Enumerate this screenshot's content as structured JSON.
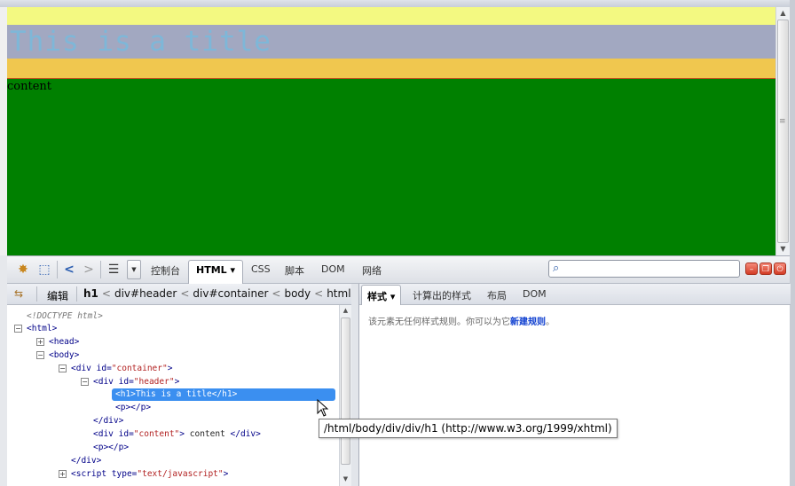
{
  "page": {
    "title_text": "This is a title",
    "content_text": "content",
    "colors": {
      "yellow": "#f3f981",
      "title_bg": "#a2a8c1",
      "title_fg": "#7eb7d8",
      "orange": "#f0c74f",
      "green": "#008000"
    }
  },
  "toolbar": {
    "icons": [
      "firebug-bug-icon",
      "inspect-element-icon",
      "back-icon",
      "forward-icon",
      "list-icon"
    ],
    "tabs": [
      {
        "label": "控制台"
      },
      {
        "label": "HTML",
        "active": true
      },
      {
        "label": "CSS"
      },
      {
        "label": "脚本"
      },
      {
        "label": "DOM"
      },
      {
        "label": "网络"
      }
    ],
    "html_dropdown": "▾",
    "search_placeholder": ""
  },
  "breadcrumb": {
    "edit_label": "编辑",
    "crumbs": [
      "h1",
      "div#header",
      "div#container",
      "body",
      "html"
    ],
    "separator": "<"
  },
  "tree": {
    "doctype": "<!DOCTYPE html>",
    "html_open": "<html>",
    "head": "<head>",
    "body": "<body>",
    "container_tag": "<div",
    "container_attr": "id=",
    "container_val": "\"container\"",
    "header_tag": "<div",
    "header_attr": "id=",
    "header_val": "\"header\"",
    "h1_open": "<h1>",
    "h1_text": "This is a title",
    "h1_close": "</h1>",
    "p_empty": "<p></p>",
    "div_close": "</div>",
    "content_tag": "<div",
    "content_attr": "id=",
    "content_val": "\"content\"",
    "content_text": "content",
    "content_close": "</div>",
    "p2_empty": "<p></p>",
    "div_close2": "</div>",
    "script_tag": "<script",
    "script_attr": "type=",
    "script_val": "\"text/javascript\"",
    "gt": ">"
  },
  "style_panel": {
    "tabs": [
      {
        "label": "样式",
        "active": true
      },
      {
        "label": "计算出的样式"
      },
      {
        "label": "布局"
      },
      {
        "label": "DOM"
      }
    ],
    "message_prefix": "该元素无任何样式规则。你可以为它",
    "message_link": "新建规则",
    "message_suffix": "。"
  },
  "tooltip": "/html/body/div/div/h1 (http://www.w3.org/1999/xhtml)"
}
